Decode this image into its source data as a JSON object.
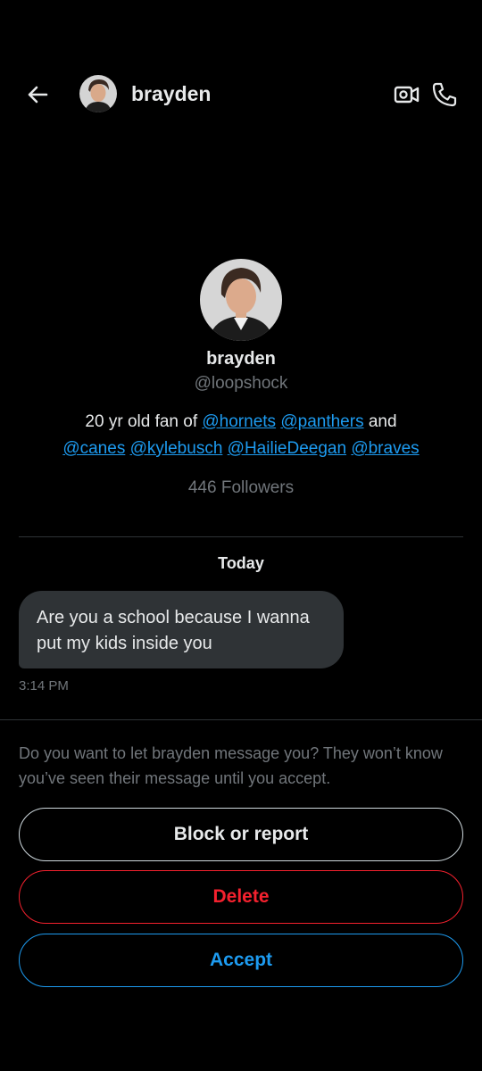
{
  "header": {
    "name": "brayden",
    "icons": [
      "back-arrow-icon",
      "video-camera-icon",
      "phone-icon"
    ]
  },
  "profile": {
    "name": "brayden",
    "handle": "@loopshock",
    "bio": {
      "prefix": "20 yr old fan of ",
      "links": [
        "@hornets",
        "@panthers",
        "@canes",
        "@kylebusch",
        "@HailieDeegan",
        "@braves"
      ],
      "conjunction": " and"
    },
    "followers": "446 Followers"
  },
  "conversation": {
    "date_label": "Today",
    "messages": [
      {
        "text": "Are you a school because I wanna put my kids inside you",
        "time": "3:14 PM"
      }
    ]
  },
  "request": {
    "prompt": "Do you want to let brayden message you? They won’t know you’ve seen their message until you accept.",
    "block_label": "Block or report",
    "delete_label": "Delete",
    "accept_label": "Accept"
  },
  "colors": {
    "background": "#000000",
    "text_primary": "#e7e9ea",
    "text_secondary": "#71767b",
    "link": "#1d9bf0",
    "bubble": "#2f3336",
    "danger": "#f4212e",
    "accent": "#1d9bf0"
  }
}
